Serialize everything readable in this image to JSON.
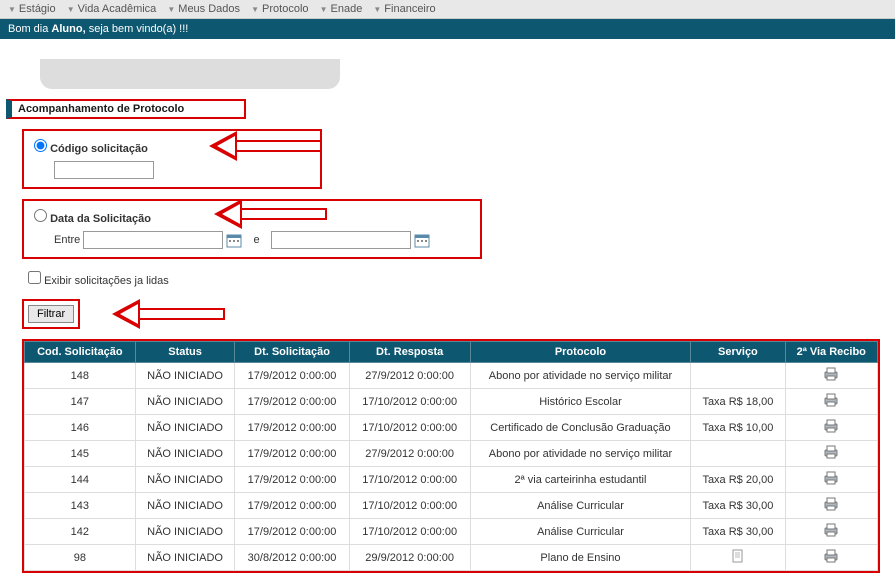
{
  "menu": [
    "Estágio",
    "Vida Acadêmica",
    "Meus Dados",
    "Protocolo",
    "Enade",
    "Financeiro"
  ],
  "welcome": {
    "pre": "Bom dia ",
    "bold": "Aluno,",
    "post": " seja bem vindo(a) !!!"
  },
  "section_title": "Acompanhamento de Protocolo",
  "filter": {
    "codigo_label": "Código solicitação",
    "data_label": "Data da Solicitação",
    "entre": "Entre",
    "e": "e",
    "codigo_value": "",
    "date_from": "",
    "date_to": ""
  },
  "exibir_label": "Exibir solicitações ja lidas",
  "filtrar_btn": "Filtrar",
  "table": {
    "headers": [
      "Cod. Solicitação",
      "Status",
      "Dt. Solicitação",
      "Dt. Resposta",
      "Protocolo",
      "Serviço",
      "2ª Via Recibo"
    ],
    "rows": [
      {
        "cod": "148",
        "status": "NÃO INICIADO",
        "dt_sol": "17/9/2012 0:00:00",
        "dt_resp": "27/9/2012 0:00:00",
        "proto": "Abono por atividade no serviço militar",
        "servico": "",
        "recibo": "printer"
      },
      {
        "cod": "147",
        "status": "NÃO INICIADO",
        "dt_sol": "17/9/2012 0:00:00",
        "dt_resp": "17/10/2012 0:00:00",
        "proto": "Histórico Escolar",
        "servico": "Taxa R$ 18,00",
        "recibo": "printer"
      },
      {
        "cod": "146",
        "status": "NÃO INICIADO",
        "dt_sol": "17/9/2012 0:00:00",
        "dt_resp": "17/10/2012 0:00:00",
        "proto": "Certificado de Conclusão Graduação",
        "servico": "Taxa R$ 10,00",
        "recibo": "printer"
      },
      {
        "cod": "145",
        "status": "NÃO INICIADO",
        "dt_sol": "17/9/2012 0:00:00",
        "dt_resp": "27/9/2012 0:00:00",
        "proto": "Abono por atividade no serviço militar",
        "servico": "",
        "recibo": "printer"
      },
      {
        "cod": "144",
        "status": "NÃO INICIADO",
        "dt_sol": "17/9/2012 0:00:00",
        "dt_resp": "17/10/2012 0:00:00",
        "proto": "2ª via carteirinha estudantil",
        "servico": "Taxa R$ 20,00",
        "recibo": "printer"
      },
      {
        "cod": "143",
        "status": "NÃO INICIADO",
        "dt_sol": "17/9/2012 0:00:00",
        "dt_resp": "17/10/2012 0:00:00",
        "proto": "Análise Curricular",
        "servico": "Taxa R$ 30,00",
        "recibo": "printer"
      },
      {
        "cod": "142",
        "status": "NÃO INICIADO",
        "dt_sol": "17/9/2012 0:00:00",
        "dt_resp": "17/10/2012 0:00:00",
        "proto": "Análise Curricular",
        "servico": "Taxa R$ 30,00",
        "recibo": "printer"
      },
      {
        "cod": "98",
        "status": "NÃO INICIADO",
        "dt_sol": "30/8/2012 0:00:00",
        "dt_resp": "29/9/2012 0:00:00",
        "proto": "Plano de Ensino",
        "servico": "doc",
        "recibo": "printer"
      }
    ]
  }
}
